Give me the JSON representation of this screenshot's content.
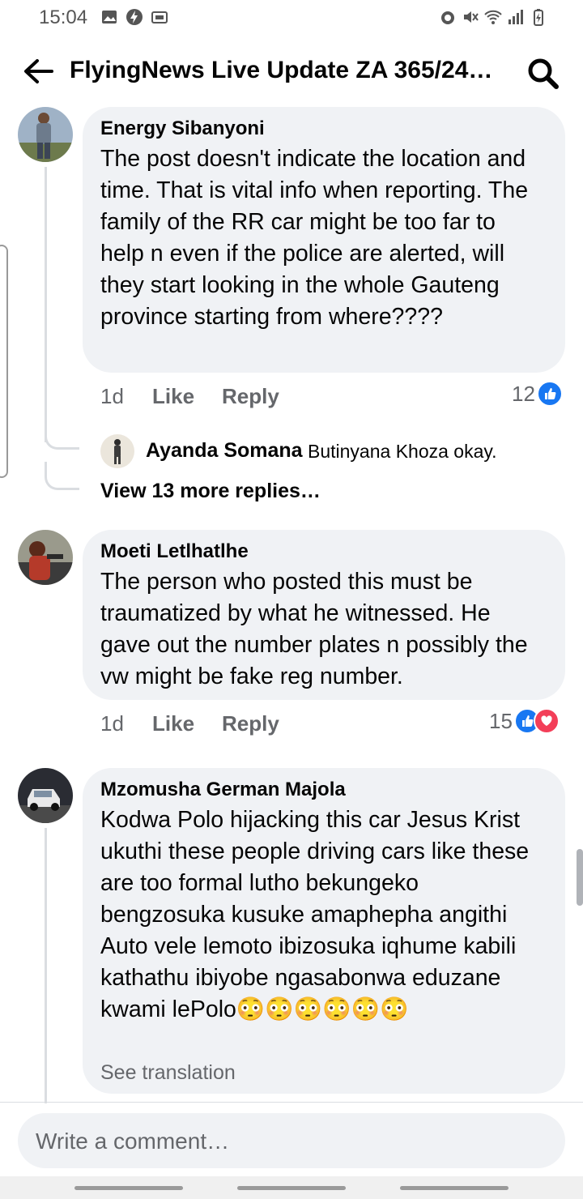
{
  "status_bar": {
    "time": "15:04",
    "left_icons": [
      "gallery-icon",
      "messenger-bolt-icon",
      "cast-icon"
    ],
    "right_icons": [
      "alarm-icon",
      "mute-icon",
      "wifi-icon",
      "signal-icon",
      "battery-charging-icon"
    ]
  },
  "header": {
    "title": "FlyingNews Live Update ZA 365/24…",
    "back_icon": "arrow-left-icon",
    "search_icon": "search-icon"
  },
  "comments": [
    {
      "author": "Energy Sibanyoni",
      "text": "The post doesn't  indicate the location and time. That is vital info when reporting. The family of the RR car might be too far to help n even if the police are alerted,  will they start looking in the whole Gauteng province starting from where????",
      "time": "1d",
      "like_label": "Like",
      "reply_label": "Reply",
      "reaction_count": "12",
      "reactions": [
        "like"
      ]
    },
    {
      "author": "Moeti Letlhatlhe",
      "text": "The person who posted this must be traumatized by what he witnessed. He gave out the number plates n possibly the vw might be fake reg number.",
      "time": "1d",
      "like_label": "Like",
      "reply_label": "Reply",
      "reaction_count": "15",
      "reactions": [
        "like",
        "love"
      ]
    },
    {
      "author": "Mzomusha German Majola",
      "text": "Kodwa Polo hijacking this car Jesus Krist ukuthi these people driving cars like these are too formal lutho bekungeko bengzosuka kusuke amaphepha angithi Auto vele lemoto ibizosuka iqhume kabili kathathu ibiyobe ngasabonwa eduzane kwami lePolo😳😳😳😳😳😳",
      "see_translation": "See translation"
    }
  ],
  "reply": {
    "author": "Ayanda Somana",
    "text": "Butinyana Khoza okay."
  },
  "view_more": "View 13 more replies…",
  "composer": {
    "placeholder": "Write a comment…"
  },
  "colors": {
    "bubble": "#f0f2f5",
    "secondary_text": "#65676b",
    "like_blue": "#1877f2",
    "love_red": "#f33e58"
  }
}
